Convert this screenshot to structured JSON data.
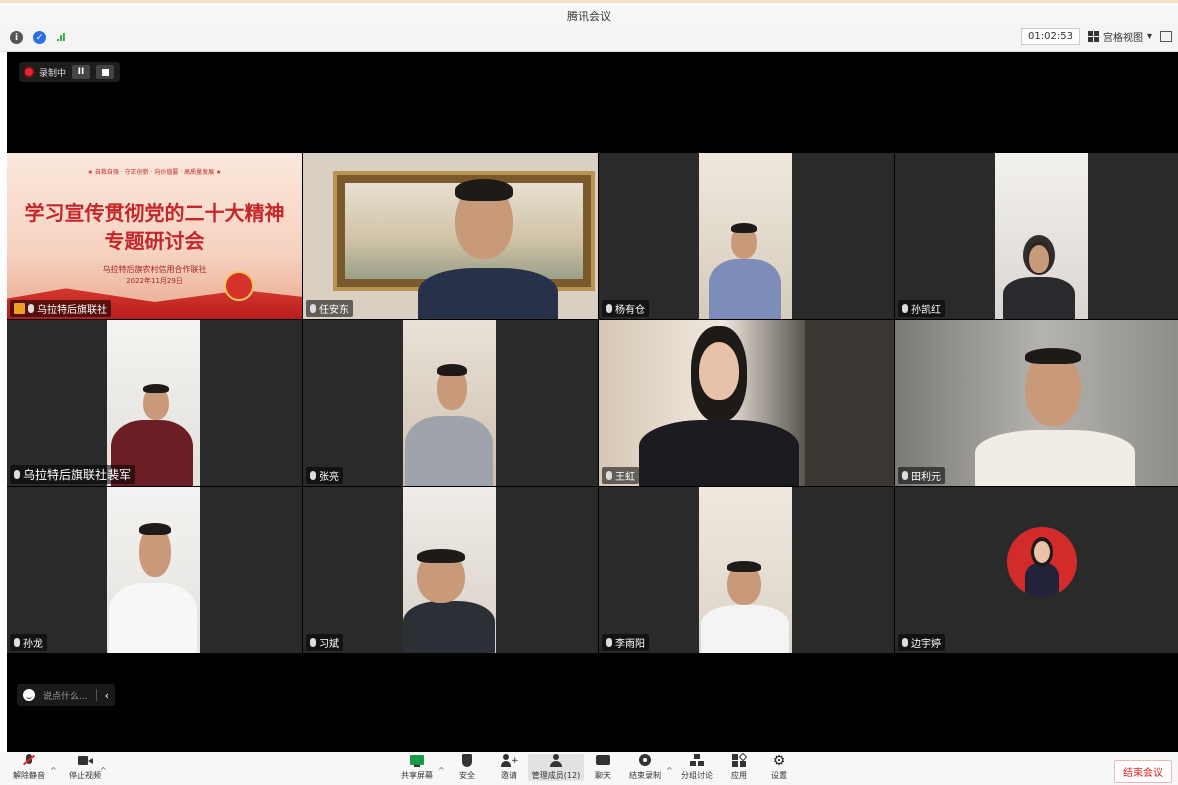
{
  "window": {
    "title": "腾讯会议"
  },
  "status": {
    "timer": "01:02:53",
    "view_mode": "宫格视图"
  },
  "recording": {
    "label": "录制中"
  },
  "participants": [
    {
      "name": "乌拉特后旗联社",
      "host": true
    },
    {
      "name": "任安东"
    },
    {
      "name": "杨有仓"
    },
    {
      "name": "孙凯红"
    },
    {
      "name": "乌拉特后旗联社裴军"
    },
    {
      "name": "张亮"
    },
    {
      "name": "王虹"
    },
    {
      "name": "田利元"
    },
    {
      "name": "孙龙"
    },
    {
      "name": "习斌"
    },
    {
      "name": "李雨阳"
    },
    {
      "name": "边宇婷"
    }
  ],
  "poster": {
    "slogan": "★ 自救自强 · 守正创新 · 向价值要 · 高质量发展 ★",
    "title_line1": "学习宣传贯彻党的二十大精神",
    "title_line2": "专题研讨会",
    "org": "乌拉特后旗农村信用合作联社",
    "date": "2022年11月29日"
  },
  "chat": {
    "placeholder": "说点什么..."
  },
  "toolbar": {
    "unmute": "解除静音",
    "stop_video": "停止视频",
    "share_screen": "共享屏幕",
    "security": "安全",
    "invite": "邀请",
    "members": "管理成员(12)",
    "chat": "聊天",
    "end_recording": "结束录制",
    "breakout": "分组讨论",
    "apps": "应用",
    "settings": "设置",
    "end_meeting": "结束会议"
  }
}
